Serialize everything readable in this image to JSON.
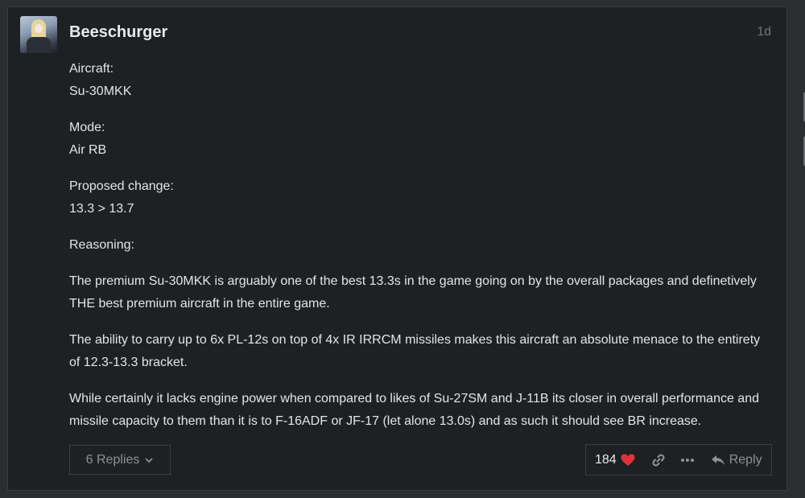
{
  "post": {
    "username": "Beeschurger",
    "age": "1d",
    "paragraphs": [
      "Aircraft:\nSu-30MKK",
      "Mode:\nAir RB",
      "Proposed change:\n13.3 > 13.7",
      "Reasoning:",
      "The premium Su-30MKK is arguably one of the best 13.3s in the game going on by the overall packages and definetively THE best premium aircraft in the entire game.",
      "The ability to carry up to 6x PL-12s on top of 4x IR IRRCM missiles makes this aircraft an absolute menace to the entirety of 12.3-13.3 bracket.",
      "While certainly it lacks engine power when compared to likes of Su-27SM and J-11B its closer in overall performance and missile capacity to them than it is to F-16ADF or JF-17 (let alone 13.0s) and as such it should see BR increase."
    ],
    "replies_label": "6 Replies",
    "like_count": "184",
    "reply_label": "Reply"
  },
  "colors": {
    "background": "#1e2123",
    "heart": "#e0333a",
    "muted": "#8c9196"
  },
  "icons": [
    "avatar",
    "chevron-down-icon",
    "heart-icon",
    "link-icon",
    "more-icon",
    "reply-arrow-icon"
  ]
}
